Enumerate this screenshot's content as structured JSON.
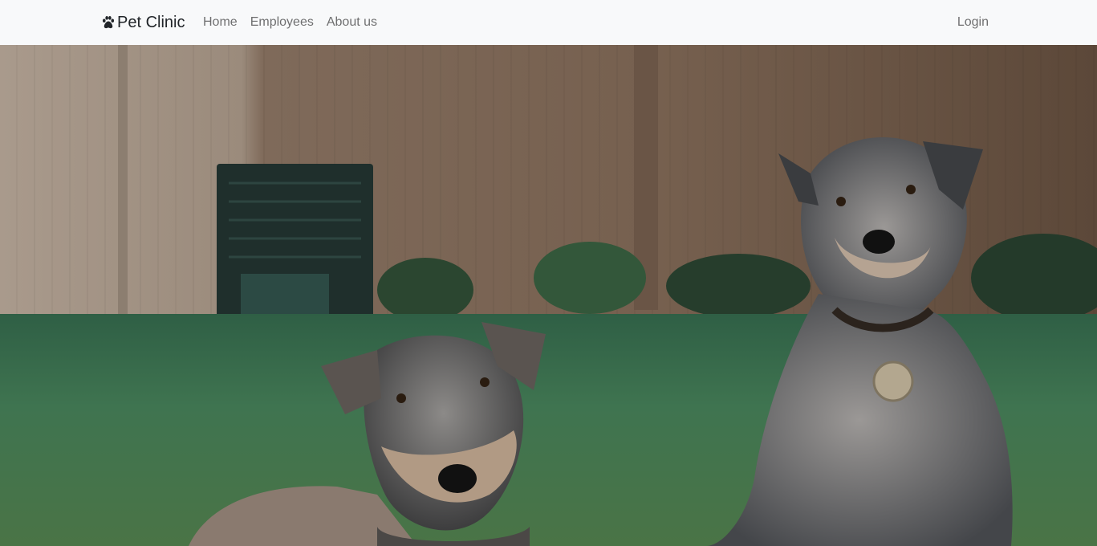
{
  "navbar": {
    "brand": "Pet Clinic",
    "brand_icon": "paw-icon",
    "links": [
      {
        "label": "Home"
      },
      {
        "label": "Employees"
      },
      {
        "label": "About us"
      }
    ],
    "login_label": "Login"
  },
  "hero": {
    "image": "photo of two schnauzer dogs on grass in front of a wooden fence"
  },
  "colors": {
    "navbar_bg": "#f8f9fa",
    "brand_text": "#212529",
    "link_text": "#6c757d"
  }
}
